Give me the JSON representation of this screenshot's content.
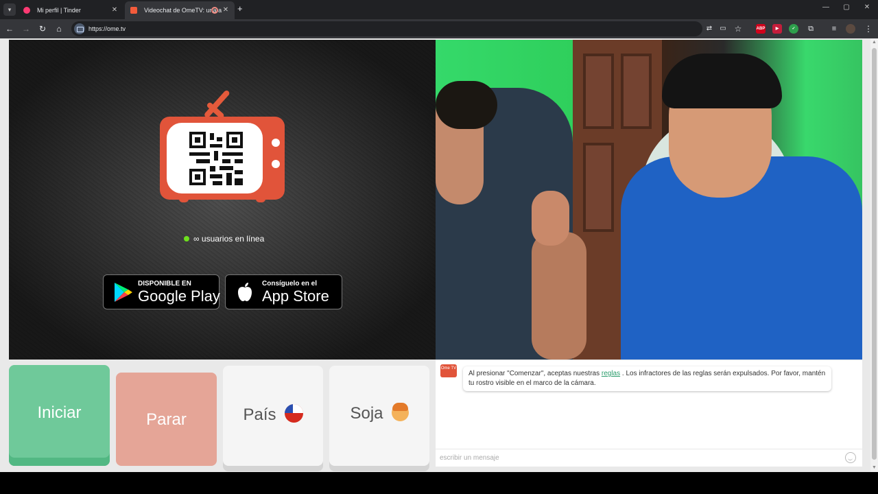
{
  "browser": {
    "tabs": [
      {
        "label": "Mi perfil | Tinder"
      },
      {
        "label": "Videochat de OmeTV: una a"
      }
    ],
    "new_tab_label": "+",
    "url": "https://ome.tv"
  },
  "left_panel": {
    "online_text": "∞ usuarios en línea",
    "google_play": {
      "small": "DISPONIBLE EN",
      "big": "Google Play"
    },
    "app_store": {
      "small": "Consíguelo en el",
      "big": "App Store"
    }
  },
  "controls": {
    "start_label": "Iniciar",
    "stop_label": "Parar",
    "country_label": "País",
    "gender_label": "Soja"
  },
  "chat": {
    "logo_text": "Ome TV",
    "message_before": "Al presionar \"Comenzar\", aceptas nuestras ",
    "message_link": "reglas",
    "message_after": " . Los infractores de las reglas serán expulsados. Por favor, mantén tu rostro visible en el marco de la cámara.",
    "input_placeholder": "escribir un mensaje"
  },
  "colors": {
    "brand": "#e1543a",
    "start": "#6fc99a",
    "stop": "#e5a597",
    "online": "#6ee01e"
  },
  "icons": [
    "tab-menu-icon",
    "tinder-icon",
    "ometv-icon",
    "recording-icon",
    "close-icon",
    "back-icon",
    "forward-icon",
    "reload-icon",
    "home-icon",
    "translate-icon",
    "cast-icon",
    "star-icon",
    "abp-icon",
    "extension-icon",
    "puzzle-icon",
    "media-icon",
    "profile-icon",
    "menu-icon",
    "google-play-icon",
    "apple-icon",
    "chile-flag-icon",
    "boy-emoji-icon",
    "smile-icon"
  ]
}
